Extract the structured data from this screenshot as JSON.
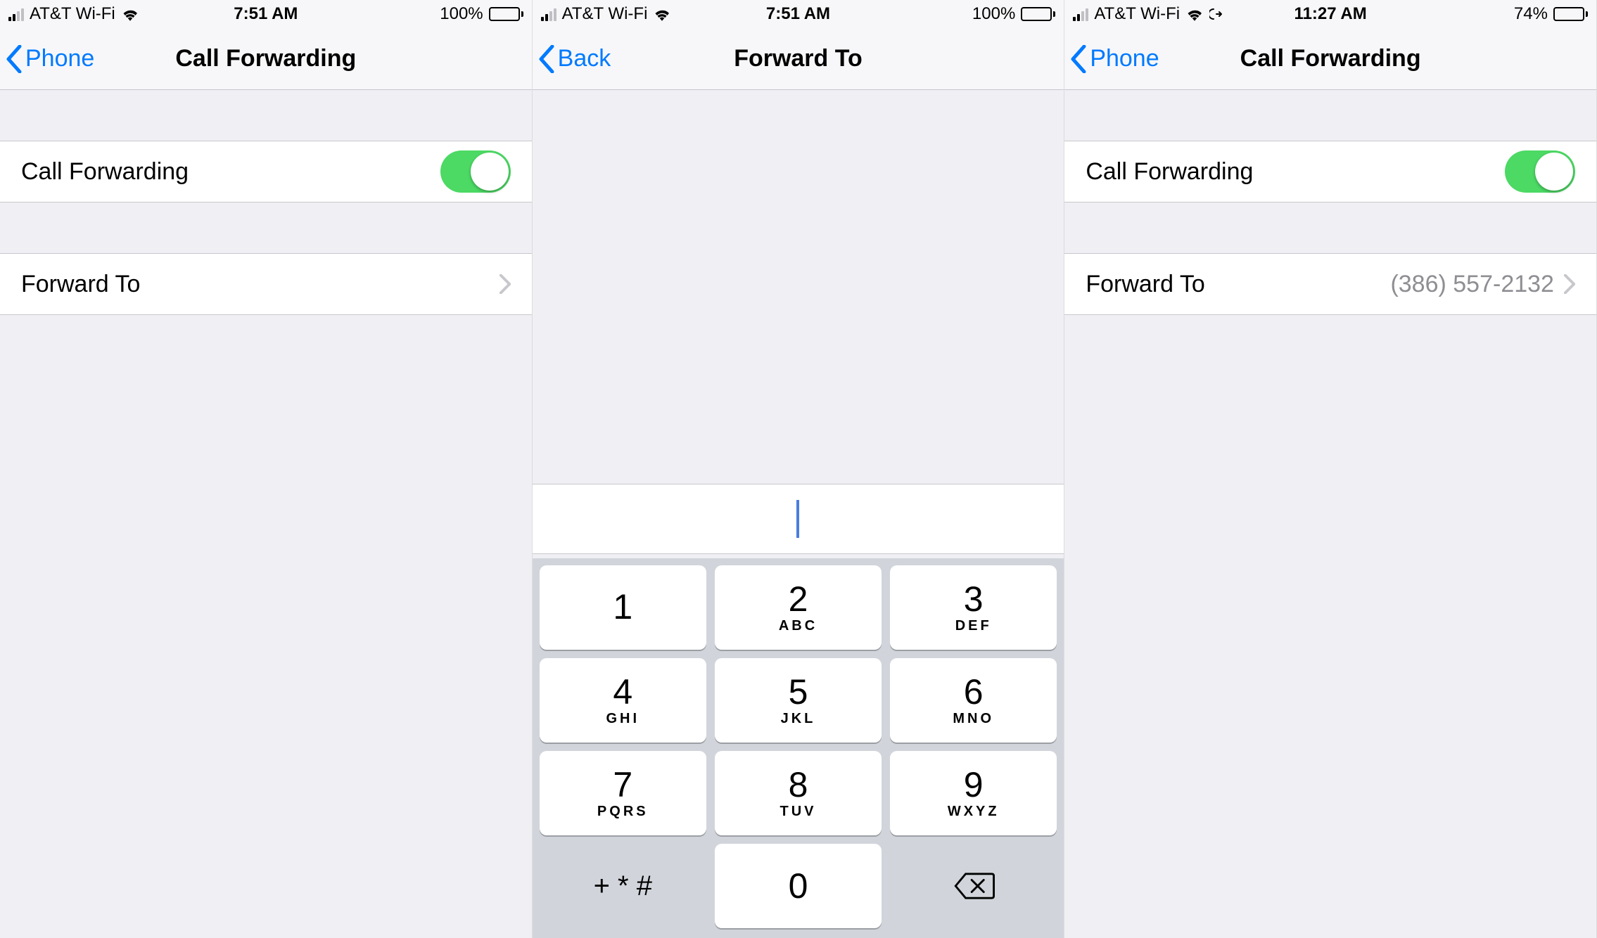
{
  "colors": {
    "ios_blue": "#007aff",
    "toggle_green": "#4cd964",
    "detail_gray": "#8e8e93"
  },
  "screens": [
    {
      "status": {
        "carrier": "AT&T Wi-Fi",
        "time": "7:51 AM",
        "battery_pct": "100%",
        "battery_fill": 100,
        "signal_bars_on": 2,
        "show_forward_icon": false
      },
      "nav": {
        "back_label": "Phone",
        "title": "Call Forwarding"
      },
      "rows": {
        "toggle_label": "Call Forwarding",
        "toggle_on": true,
        "forward_label": "Forward To",
        "forward_value": ""
      }
    },
    {
      "status": {
        "carrier": "AT&T Wi-Fi",
        "time": "7:51 AM",
        "battery_pct": "100%",
        "battery_fill": 100,
        "signal_bars_on": 2,
        "show_forward_icon": false
      },
      "nav": {
        "back_label": "Back",
        "title": "Forward To"
      },
      "input_value": "",
      "keypad": [
        {
          "digit": "1",
          "letters": ""
        },
        {
          "digit": "2",
          "letters": "ABC"
        },
        {
          "digit": "3",
          "letters": "DEF"
        },
        {
          "digit": "4",
          "letters": "GHI"
        },
        {
          "digit": "5",
          "letters": "JKL"
        },
        {
          "digit": "6",
          "letters": "MNO"
        },
        {
          "digit": "7",
          "letters": "PQRS"
        },
        {
          "digit": "8",
          "letters": "TUV"
        },
        {
          "digit": "9",
          "letters": "WXYZ"
        }
      ],
      "keypad_symbols": "+ * #",
      "keypad_zero": "0"
    },
    {
      "status": {
        "carrier": "AT&T Wi-Fi",
        "time": "11:27 AM",
        "battery_pct": "74%",
        "battery_fill": 74,
        "signal_bars_on": 2,
        "show_forward_icon": true
      },
      "nav": {
        "back_label": "Phone",
        "title": "Call Forwarding"
      },
      "rows": {
        "toggle_label": "Call Forwarding",
        "toggle_on": true,
        "forward_label": "Forward To",
        "forward_value": "(386) 557-2132"
      }
    }
  ]
}
